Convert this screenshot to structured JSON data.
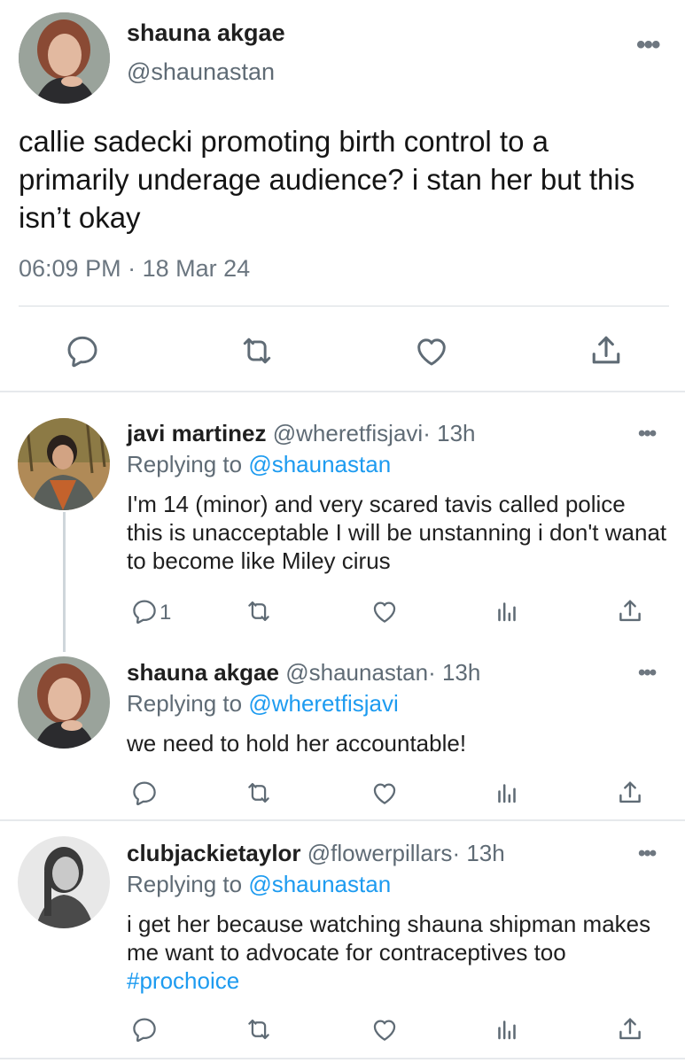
{
  "main_tweet": {
    "name": "shauna akgae",
    "handle": "@shaunastan",
    "text": "callie sadecki promoting birth control to a primarily underage audience? i stan her but this isn’t okay",
    "time": "06:09 PM",
    "separator": "·",
    "date": "18 Mar 24",
    "more": "•••"
  },
  "replies": [
    {
      "name": "javi martinez",
      "handle": "@wheretfisjavi",
      "dot": "·",
      "time": "13h",
      "replying_prefix": "Replying to",
      "replying_to": "@shaunastan",
      "text": "I'm 14 (minor) and very scared tavis called police this is unacceptable I will be unstanning i don't wanat to become like Miley cirus",
      "reply_count": "1",
      "more": "•••"
    },
    {
      "name": "shauna akgae",
      "handle": "@shaunastan",
      "dot": "·",
      "time": "13h",
      "replying_prefix": "Replying to",
      "replying_to": "@wheretfisjavi",
      "text": "we need to hold her accountable!",
      "more": "•••"
    },
    {
      "name": "clubjackietaylor",
      "handle": "@flowerpillars",
      "dot": "·",
      "time": "13h",
      "replying_prefix": "Replying to",
      "replying_to": "@shaunastan",
      "text_before": "i get her because watching shauna shipman makes me want to advocate for contraceptives too ",
      "hashtag": "#prochoice",
      "more": "•••"
    }
  ],
  "icons": {
    "reply": "reply-icon",
    "retweet": "retweet-icon",
    "like": "heart-icon",
    "analytics": "analytics-icon",
    "share": "share-icon",
    "more": "more-icon"
  },
  "colors": {
    "link": "#1d9bf0",
    "secondary_text": "#5f6b75",
    "icon": "#5f6b75"
  }
}
